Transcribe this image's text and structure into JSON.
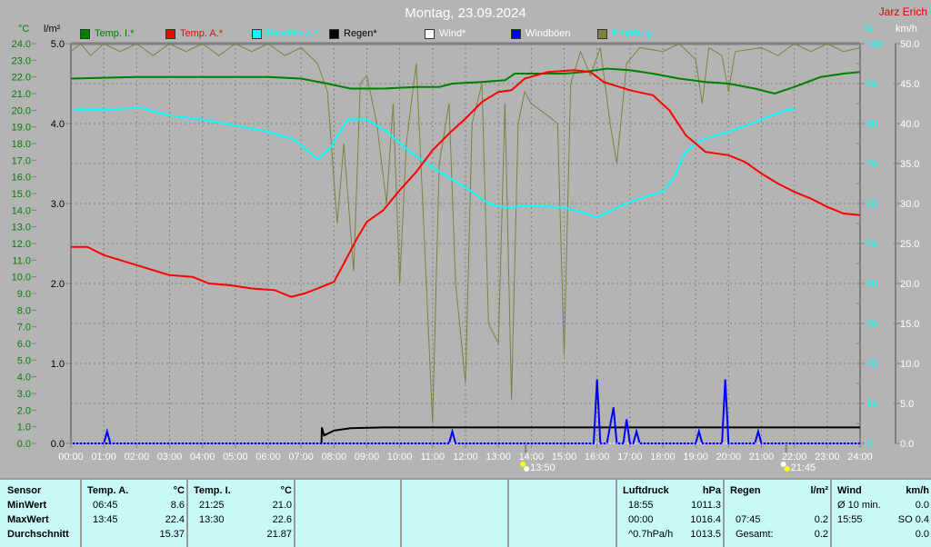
{
  "title": "Montag, 23.09.2024",
  "author": "Jarz Erich",
  "axis_units": {
    "temp": "°C",
    "rain": "l/m²",
    "hum": "%",
    "wind": "km/h"
  },
  "legend": [
    {
      "label": "Temp. I.*",
      "color": "#008000",
      "text": "#008000"
    },
    {
      "label": "Temp. A.*",
      "color": "#ff0000",
      "text": "#ff0000"
    },
    {
      "label": "Feuchte A.*",
      "color": "#00ffff",
      "text": "#00ffff"
    },
    {
      "label": "Regen*",
      "color": "#000000",
      "text": "#000000"
    },
    {
      "label": "Wind*",
      "color": "#ffffff",
      "text": "#ffffff"
    },
    {
      "label": "Windböen",
      "color": "#0000ff",
      "text": "#ffffff"
    },
    {
      "label": "Empfang",
      "color": "#808040",
      "text": "#00ffff"
    }
  ],
  "annotations": [
    {
      "time": "13:50",
      "hour": 13.83
    },
    {
      "time": "21:45",
      "hour": 21.75
    }
  ],
  "chart_data": {
    "type": "line",
    "title": "Montag, 23.09.2024",
    "xlabel": "",
    "xlim": [
      0,
      24
    ],
    "x_ticks": [
      "00:00",
      "01:00",
      "02:00",
      "03:00",
      "04:00",
      "05:00",
      "06:00",
      "07:00",
      "08:00",
      "09:00",
      "10:00",
      "11:00",
      "12:00",
      "13:00",
      "14:00",
      "15:00",
      "16:00",
      "17:00",
      "18:00",
      "19:00",
      "20:00",
      "21:00",
      "22:00",
      "23:00",
      "24:00"
    ],
    "y_axes": {
      "temp": {
        "unit": "°C",
        "range": [
          0,
          24
        ],
        "ticks": [
          "0.0",
          "1.0",
          "2.0",
          "3.0",
          "4.0",
          "5.0",
          "6.0",
          "7.0",
          "8.0",
          "9.0",
          "10.0",
          "11.0",
          "12.0",
          "13.0",
          "14.0",
          "15.0",
          "16.0",
          "17.0",
          "18.0",
          "19.0",
          "20.0",
          "21.0",
          "22.0",
          "23.0",
          "24.0"
        ]
      },
      "rain": {
        "unit": "l/m²",
        "range": [
          0,
          5
        ],
        "ticks": [
          "0.0",
          "1.0",
          "2.0",
          "3.0",
          "4.0",
          "5.0"
        ]
      },
      "hum": {
        "unit": "%",
        "range": [
          0,
          100
        ],
        "ticks": [
          "0",
          "10",
          "20",
          "30",
          "40",
          "50",
          "60",
          "70",
          "80",
          "90",
          "100"
        ]
      },
      "wind": {
        "unit": "km/h",
        "range": [
          0,
          50
        ],
        "ticks": [
          "0.0",
          "5.0",
          "10.0",
          "15.0",
          "20.0",
          "25.0",
          "30.0",
          "35.0",
          "40.0",
          "45.0",
          "50.0"
        ]
      }
    },
    "grid": true,
    "series": [
      {
        "name": "Empfang",
        "axis": "hum",
        "color": "#808040",
        "points": [
          [
            0,
            98
          ],
          [
            0.3,
            100
          ],
          [
            0.6,
            97
          ],
          [
            1,
            100
          ],
          [
            1.5,
            98
          ],
          [
            2,
            100
          ],
          [
            2.5,
            97
          ],
          [
            3,
            100
          ],
          [
            3.5,
            98
          ],
          [
            4,
            100
          ],
          [
            4.5,
            97
          ],
          [
            5,
            100
          ],
          [
            5.5,
            98
          ],
          [
            6,
            100
          ],
          [
            6.5,
            97
          ],
          [
            7,
            99
          ],
          [
            7.5,
            95
          ],
          [
            7.8,
            88
          ],
          [
            8.1,
            55
          ],
          [
            8.3,
            75
          ],
          [
            8.6,
            43
          ],
          [
            8.8,
            90
          ],
          [
            9,
            92
          ],
          [
            9.3,
            80
          ],
          [
            9.6,
            60
          ],
          [
            9.8,
            85
          ],
          [
            10,
            40
          ],
          [
            10.2,
            75
          ],
          [
            10.5,
            95
          ],
          [
            10.7,
            60
          ],
          [
            11,
            5
          ],
          [
            11.2,
            70
          ],
          [
            11.5,
            85
          ],
          [
            11.7,
            40
          ],
          [
            12,
            15
          ],
          [
            12.2,
            80
          ],
          [
            12.5,
            90
          ],
          [
            12.7,
            30
          ],
          [
            13,
            25
          ],
          [
            13.2,
            85
          ],
          [
            13.4,
            11
          ],
          [
            13.6,
            80
          ],
          [
            13.8,
            88
          ],
          [
            14,
            85
          ],
          [
            14.5,
            82
          ],
          [
            14.8,
            80
          ],
          [
            15,
            22
          ],
          [
            15.2,
            90
          ],
          [
            15.5,
            98
          ],
          [
            15.8,
            92
          ],
          [
            16.1,
            99
          ],
          [
            16.4,
            80
          ],
          [
            16.6,
            70
          ],
          [
            16.9,
            95
          ],
          [
            17.3,
            99
          ],
          [
            18,
            98
          ],
          [
            18.5,
            100
          ],
          [
            19,
            96
          ],
          [
            19.2,
            85
          ],
          [
            19.4,
            99
          ],
          [
            19.8,
            97
          ],
          [
            20,
            88
          ],
          [
            20.2,
            98
          ],
          [
            21,
            99
          ],
          [
            21.5,
            97
          ],
          [
            22,
            100
          ],
          [
            22.5,
            98
          ],
          [
            23,
            100
          ],
          [
            23.5,
            98
          ],
          [
            24,
            99
          ]
        ]
      },
      {
        "name": "Feuchte A.*",
        "axis": "hum",
        "color": "#00ffff",
        "points": [
          [
            0.1,
            83.5
          ],
          [
            1.2,
            83.5
          ],
          [
            2.1,
            84
          ],
          [
            3,
            82
          ],
          [
            4,
            81
          ],
          [
            5,
            79.5
          ],
          [
            6,
            78
          ],
          [
            6.8,
            76
          ],
          [
            7.5,
            71
          ],
          [
            7.9,
            74
          ],
          [
            8.4,
            81
          ],
          [
            9,
            81
          ],
          [
            9.6,
            78
          ],
          [
            10.3,
            73
          ],
          [
            11,
            69
          ],
          [
            12,
            64
          ],
          [
            12.7,
            60
          ],
          [
            13.2,
            59
          ],
          [
            14,
            59.5
          ],
          [
            15,
            59
          ],
          [
            15.5,
            58
          ],
          [
            16,
            56.5
          ],
          [
            16.6,
            59
          ],
          [
            17.2,
            61
          ],
          [
            18,
            63
          ],
          [
            18.3,
            66
          ],
          [
            18.7,
            73
          ],
          [
            19.2,
            76
          ],
          [
            20,
            78
          ],
          [
            20.7,
            80
          ],
          [
            21.3,
            82
          ],
          [
            21.8,
            83.5
          ],
          [
            22,
            83.5
          ]
        ]
      },
      {
        "name": "Temp. I.*",
        "axis": "temp",
        "color": "#008000",
        "points": [
          [
            0,
            21.9
          ],
          [
            2,
            22.0
          ],
          [
            4,
            22.0
          ],
          [
            6,
            22.0
          ],
          [
            7,
            21.9
          ],
          [
            7.8,
            21.6
          ],
          [
            8.5,
            21.3
          ],
          [
            9.5,
            21.3
          ],
          [
            10.5,
            21.4
          ],
          [
            11.2,
            21.4
          ],
          [
            11.6,
            21.6
          ],
          [
            12.5,
            21.7
          ],
          [
            13.2,
            21.8
          ],
          [
            13.5,
            22.2
          ],
          [
            14.2,
            22.2
          ],
          [
            15,
            22.2
          ],
          [
            15.6,
            22.3
          ],
          [
            16.3,
            22.5
          ],
          [
            17,
            22.4
          ],
          [
            17.7,
            22.2
          ],
          [
            18.5,
            21.9
          ],
          [
            19.3,
            21.7
          ],
          [
            20,
            21.6
          ],
          [
            20.8,
            21.3
          ],
          [
            21.4,
            21.0
          ],
          [
            22,
            21.4
          ],
          [
            22.8,
            22.0
          ],
          [
            23.5,
            22.2
          ],
          [
            24,
            22.3
          ]
        ]
      },
      {
        "name": "Temp. A.*",
        "axis": "temp",
        "color": "#ff0000",
        "points": [
          [
            0,
            11.8
          ],
          [
            0.5,
            11.8
          ],
          [
            1,
            11.3
          ],
          [
            1.5,
            11.0
          ],
          [
            2,
            10.7
          ],
          [
            2.5,
            10.4
          ],
          [
            3,
            10.1
          ],
          [
            3.7,
            10.0
          ],
          [
            4.2,
            9.6
          ],
          [
            4.8,
            9.5
          ],
          [
            5.5,
            9.3
          ],
          [
            6.2,
            9.2
          ],
          [
            6.7,
            8.8
          ],
          [
            7.1,
            9.0
          ],
          [
            7.5,
            9.3
          ],
          [
            8,
            9.7
          ],
          [
            8.3,
            10.8
          ],
          [
            8.7,
            12.3
          ],
          [
            9,
            13.3
          ],
          [
            9.5,
            14.0
          ],
          [
            10,
            15.2
          ],
          [
            10.5,
            16.3
          ],
          [
            11,
            17.6
          ],
          [
            11.5,
            18.6
          ],
          [
            12,
            19.5
          ],
          [
            12.5,
            20.5
          ],
          [
            13,
            21.1
          ],
          [
            13.4,
            21.2
          ],
          [
            13.8,
            21.9
          ],
          [
            14.5,
            22.3
          ],
          [
            15.3,
            22.4
          ],
          [
            15.8,
            22.3
          ],
          [
            16.2,
            21.7
          ],
          [
            17,
            21.2
          ],
          [
            17.7,
            20.9
          ],
          [
            18.2,
            20.0
          ],
          [
            18.7,
            18.5
          ],
          [
            19.3,
            17.5
          ],
          [
            20,
            17.3
          ],
          [
            20.5,
            16.9
          ],
          [
            21,
            16.2
          ],
          [
            21.5,
            15.6
          ],
          [
            22,
            15.1
          ],
          [
            22.5,
            14.7
          ],
          [
            23,
            14.2
          ],
          [
            23.5,
            13.8
          ],
          [
            24,
            13.7
          ]
        ]
      },
      {
        "name": "Regen*",
        "axis": "rain",
        "color": "#000000",
        "points": [
          [
            0,
            0
          ],
          [
            7.62,
            0
          ],
          [
            7.63,
            0.2
          ],
          [
            7.7,
            0.1
          ],
          [
            8,
            0.16
          ],
          [
            8.5,
            0.19
          ],
          [
            9.5,
            0.2
          ],
          [
            24,
            0.2
          ]
        ]
      },
      {
        "name": "Windböen",
        "axis": "wind",
        "color": "#0000ff",
        "points": [
          [
            0,
            0
          ],
          [
            1,
            0
          ],
          [
            1.1,
            1.5
          ],
          [
            1.2,
            0
          ],
          [
            11.5,
            0
          ],
          [
            11.6,
            1.5
          ],
          [
            11.7,
            0
          ],
          [
            15.9,
            0
          ],
          [
            16.0,
            8.0
          ],
          [
            16.1,
            0
          ],
          [
            16.3,
            0
          ],
          [
            16.5,
            4.5
          ],
          [
            16.6,
            0
          ],
          [
            16.8,
            0
          ],
          [
            16.9,
            3.0
          ],
          [
            17.0,
            0
          ],
          [
            17.1,
            0
          ],
          [
            17.2,
            1.5
          ],
          [
            17.3,
            0
          ],
          [
            19.0,
            0
          ],
          [
            19.1,
            1.5
          ],
          [
            19.2,
            0
          ],
          [
            19.8,
            0
          ],
          [
            19.9,
            8.0
          ],
          [
            20.0,
            0
          ],
          [
            20.8,
            0
          ],
          [
            20.9,
            1.5
          ],
          [
            21.0,
            0
          ],
          [
            24,
            0
          ]
        ]
      }
    ]
  },
  "table": {
    "sensor": {
      "header": "Sensor",
      "rows": [
        "MinWert",
        "MaxWert",
        "Durchschnitt"
      ]
    },
    "temp_a": {
      "header": "Temp. A.",
      "unit": "°C",
      "rows": [
        [
          "06:45",
          "8.6"
        ],
        [
          "13:45",
          "22.4"
        ],
        [
          "",
          "15.37"
        ]
      ]
    },
    "temp_i": {
      "header": "Temp. I.",
      "unit": "°C",
      "rows": [
        [
          "21:25",
          "21.0"
        ],
        [
          "13:30",
          "22.6"
        ],
        [
          "",
          "21.87"
        ]
      ]
    },
    "pressure": {
      "header": "Luftdruck",
      "unit": "hPa",
      "rows": [
        [
          "18:55",
          "1011.3"
        ],
        [
          "00:00",
          "1016.4"
        ],
        [
          "^0.7hPa/h",
          "1013.5"
        ]
      ]
    },
    "rain": {
      "header": "Regen",
      "unit": "l/m²",
      "rows": [
        [
          "",
          ""
        ],
        [
          "07:45",
          "0.2"
        ],
        [
          "Gesamt:",
          "0.2"
        ]
      ]
    },
    "wind": {
      "header": "Wind",
      "unit": "km/h",
      "rows": [
        [
          "Ø 10 min.",
          "0.0"
        ],
        [
          "15:55",
          "SO 0.4"
        ],
        [
          "",
          "0.0"
        ]
      ]
    }
  }
}
